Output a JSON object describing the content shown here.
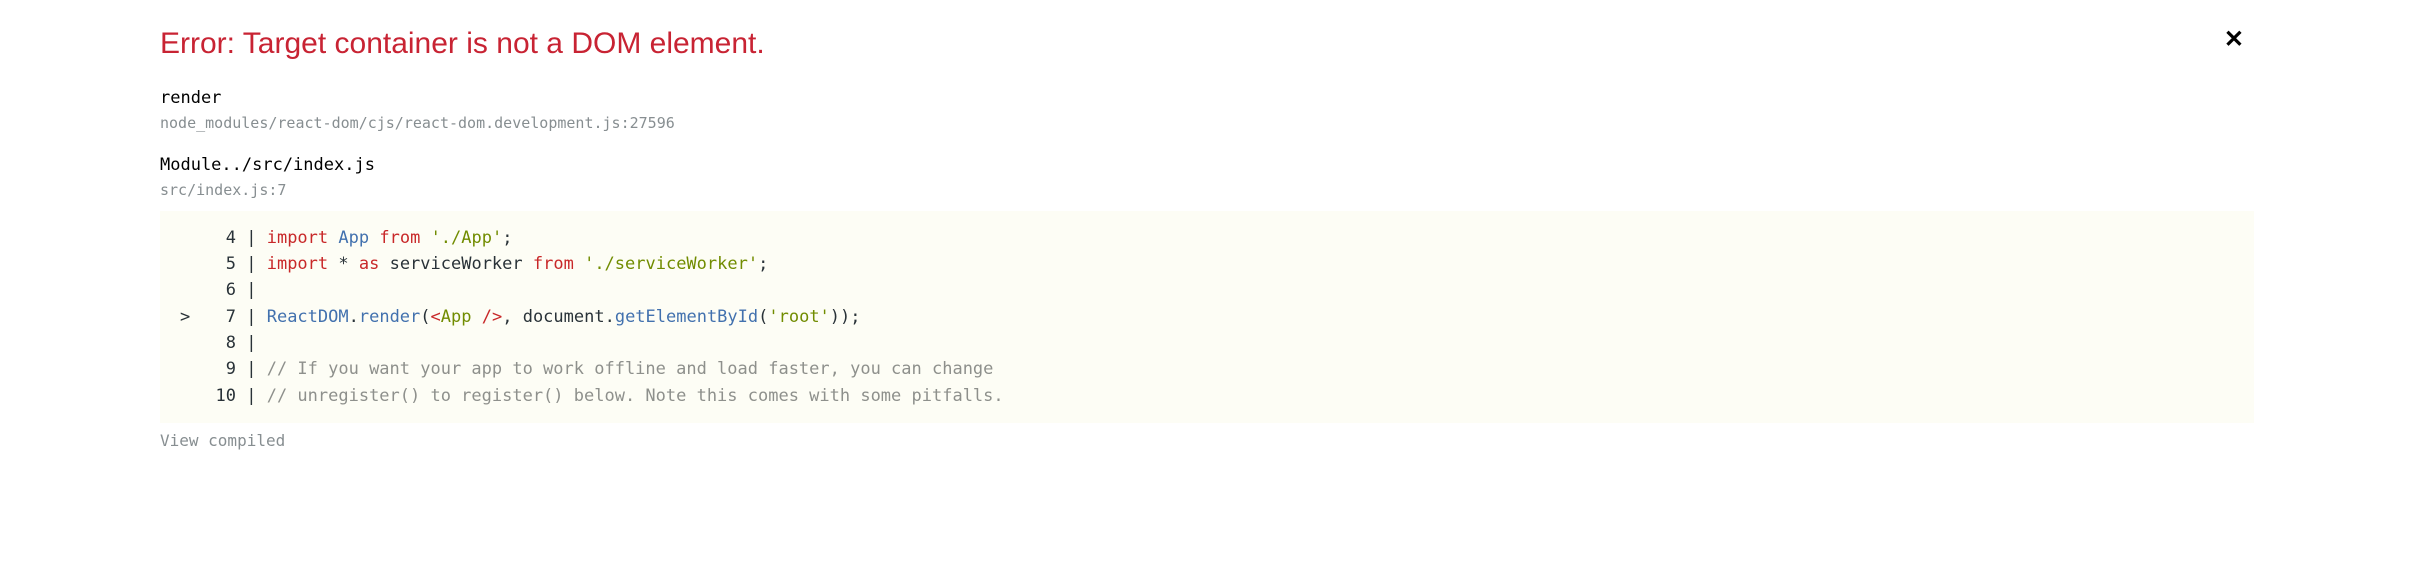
{
  "error": {
    "title": "Error: Target container is not a DOM element."
  },
  "frames": [
    {
      "name": "render",
      "location": "node_modules/react-dom/cjs/react-dom.development.js:27596"
    },
    {
      "name": "Module../src/index.js",
      "location": "src/index.js:7"
    }
  ],
  "code": {
    "lines": [
      {
        "num": "4",
        "pointer": " ",
        "tokens": [
          {
            "cls": "tok-keyword",
            "t": "import"
          },
          {
            "cls": "tok-plain",
            "t": " "
          },
          {
            "cls": "tok-ident",
            "t": "App"
          },
          {
            "cls": "tok-plain",
            "t": " "
          },
          {
            "cls": "tok-keyword",
            "t": "from"
          },
          {
            "cls": "tok-plain",
            "t": " "
          },
          {
            "cls": "tok-string",
            "t": "'./App'"
          },
          {
            "cls": "tok-plain",
            "t": ";"
          }
        ]
      },
      {
        "num": "5",
        "pointer": " ",
        "tokens": [
          {
            "cls": "tok-keyword",
            "t": "import"
          },
          {
            "cls": "tok-plain",
            "t": " * "
          },
          {
            "cls": "tok-keyword",
            "t": "as"
          },
          {
            "cls": "tok-plain",
            "t": " serviceWorker "
          },
          {
            "cls": "tok-keyword",
            "t": "from"
          },
          {
            "cls": "tok-plain",
            "t": " "
          },
          {
            "cls": "tok-string",
            "t": "'./serviceWorker'"
          },
          {
            "cls": "tok-plain",
            "t": ";"
          }
        ]
      },
      {
        "num": "6",
        "pointer": " ",
        "tokens": []
      },
      {
        "num": "7",
        "pointer": ">",
        "tokens": [
          {
            "cls": "tok-ident",
            "t": "ReactDOM"
          },
          {
            "cls": "tok-plain",
            "t": "."
          },
          {
            "cls": "tok-ident",
            "t": "render"
          },
          {
            "cls": "tok-plain",
            "t": "("
          },
          {
            "cls": "tok-tag",
            "t": "<"
          },
          {
            "cls": "tok-tagname",
            "t": "App"
          },
          {
            "cls": "tok-plain",
            "t": " "
          },
          {
            "cls": "tok-tag",
            "t": "/>"
          },
          {
            "cls": "tok-plain",
            "t": ", document."
          },
          {
            "cls": "tok-ident",
            "t": "getElementById"
          },
          {
            "cls": "tok-plain",
            "t": "("
          },
          {
            "cls": "tok-string",
            "t": "'root'"
          },
          {
            "cls": "tok-plain",
            "t": "));"
          }
        ]
      },
      {
        "num": "8",
        "pointer": " ",
        "tokens": []
      },
      {
        "num": "9",
        "pointer": " ",
        "tokens": [
          {
            "cls": "tok-comment",
            "t": "// If you want your app to work offline and load faster, you can change"
          }
        ]
      },
      {
        "num": "10",
        "pointer": " ",
        "tokens": [
          {
            "cls": "tok-comment",
            "t": "// unregister() to register() below. Note this comes with some pitfalls."
          }
        ]
      }
    ]
  },
  "footer": {
    "view_compiled": "View compiled"
  }
}
